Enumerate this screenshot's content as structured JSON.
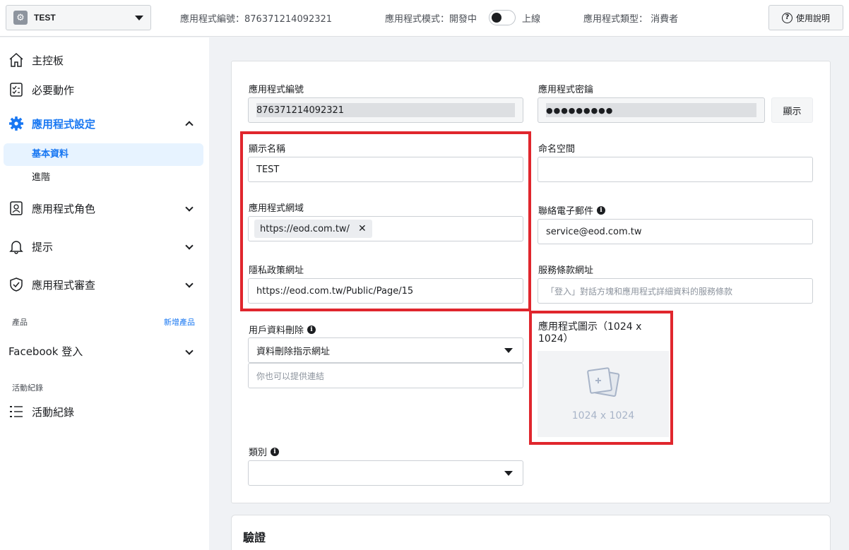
{
  "topbar": {
    "app_name": "TEST",
    "app_id_text": "應用程式編號：876371214092321",
    "mode_label": "應用程式模式：開發中",
    "mode_live": "上線",
    "type_text": "應用程式類型： 消費者",
    "help_label": "使用說明"
  },
  "sidebar": {
    "dashboard": "主控板",
    "required_actions": "必要動作",
    "app_settings": "應用程式設定",
    "basic": "基本資料",
    "advanced": "進階",
    "roles": "應用程式角色",
    "alerts": "提示",
    "review": "應用程式審查",
    "products_label": "產品",
    "add_product": "新增產品",
    "facebook_login": "Facebook 登入",
    "activity_label": "活動紀錄",
    "activity": "活動紀錄"
  },
  "form": {
    "app_id_label": "應用程式編號",
    "app_id_value": "876371214092321",
    "app_secret_label": "應用程式密鑰",
    "app_secret_value": "●●●●●●●●●",
    "show_label": "顯示",
    "display_name_label": "顯示名稱",
    "display_name_value": "TEST",
    "namespace_label": "命名空間",
    "domain_label": "應用程式網域",
    "domain_chip": "https://eod.com.tw/",
    "contact_email_label": "聯絡電子郵件",
    "contact_email_value": "service@eod.com.tw",
    "privacy_label": "隱私政策網址",
    "privacy_value": "https://eod.com.tw/Public/Page/15",
    "tos_label": "服務條款網址",
    "tos_placeholder": "「登入」對話方塊和應用程式詳細資料的服務條款",
    "deletion_label": "用戶資料刪除",
    "deletion_select": "資料刪除指示網址",
    "deletion_placeholder": "你也可以提供連結",
    "icon_label_1": "應用程式圖示（1024 x",
    "icon_label_2": "1024）",
    "icon_size": "1024 x 1024",
    "category_label": "類別",
    "category_value": ""
  },
  "verification": {
    "title": "驗證"
  },
  "colors": {
    "accent": "#1877f2",
    "highlight_box": "#e0262d"
  }
}
